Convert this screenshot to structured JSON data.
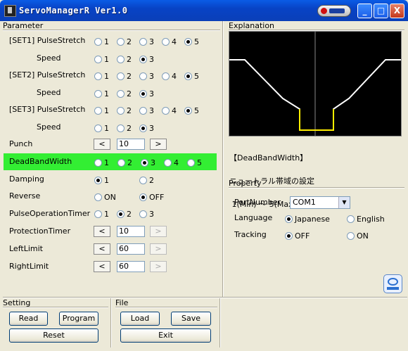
{
  "window": {
    "title": "ServoManagerR Ver1.0",
    "min_label": "_",
    "max_label": "□",
    "close_label": "X"
  },
  "parameter": {
    "group_title": "Parameter",
    "rows": [
      {
        "label": "[SET1] PulseStretch",
        "options": [
          "1",
          "2",
          "3",
          "4",
          "5"
        ],
        "selected": "5"
      },
      {
        "label": "Speed",
        "options": [
          "1",
          "2",
          "3"
        ],
        "selected": "3"
      },
      {
        "label": "[SET2] PulseStretch",
        "options": [
          "1",
          "2",
          "3",
          "4",
          "5"
        ],
        "selected": "5"
      },
      {
        "label": "Speed",
        "options": [
          "1",
          "2",
          "3"
        ],
        "selected": "3"
      },
      {
        "label": "[SET3] PulseStretch",
        "options": [
          "1",
          "2",
          "3",
          "4",
          "5"
        ],
        "selected": "5"
      },
      {
        "label": "Speed",
        "options": [
          "1",
          "2",
          "3"
        ],
        "selected": "3"
      }
    ],
    "punch": {
      "label": "Punch",
      "dec": "<",
      "inc": ">",
      "value": "10"
    },
    "deadband": {
      "label": "DeadBandWidth",
      "options": [
        "1",
        "2",
        "3",
        "4",
        "5"
      ],
      "selected": "3"
    },
    "damping": {
      "label": "Damping",
      "options": [
        "1",
        "2"
      ],
      "selected": "1"
    },
    "reverse": {
      "label": "Reverse",
      "options": [
        "ON",
        "OFF"
      ],
      "selected": "OFF"
    },
    "pulse_op_timer": {
      "label": "PulseOperationTimer",
      "options": [
        "1",
        "2",
        "3"
      ],
      "selected": "2"
    },
    "protection_timer": {
      "label": "ProtectionTimer",
      "dec": "<",
      "inc": ">",
      "value": "10"
    },
    "left_limit": {
      "label": "LeftLimit",
      "dec": "<",
      "inc": ">",
      "value": "60"
    },
    "right_limit": {
      "label": "RightLimit",
      "dec": "<",
      "inc": ">",
      "value": "60"
    }
  },
  "explanation": {
    "group_title": "Explanation",
    "text_line1": "【DeadBandWidth】",
    "text_line2": "ニュートラル帯域の設定",
    "text_line3": " 1(Min) ～ 5(Max)"
  },
  "property": {
    "group_title": "Property",
    "port_label": "PortNumber",
    "port_value": "COM1",
    "language_label": "Language",
    "language_options": [
      "Japanese",
      "English"
    ],
    "language_selected": "Japanese",
    "tracking_label": "Tracking",
    "tracking_options": [
      "OFF",
      "ON"
    ],
    "tracking_selected": "OFF"
  },
  "setting": {
    "group_title": "Setting",
    "read": "Read",
    "program": "Program",
    "reset": "Reset"
  },
  "file": {
    "group_title": "File",
    "load": "Load",
    "save": "Save",
    "exit": "Exit"
  },
  "colors": {
    "titlebar": "#0a5ce6",
    "highlight": "#33ee33",
    "graph_line": "#ffffff",
    "graph_deadband": "#ffee00"
  }
}
